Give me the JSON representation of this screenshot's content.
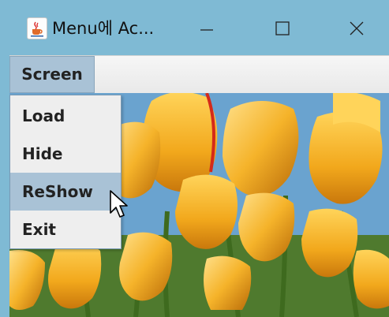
{
  "window": {
    "title": "Menu에 Ac...",
    "icon": "java-cup-icon",
    "controls": {
      "minimize": "minimize-icon",
      "maximize": "maximize-icon",
      "close": "close-icon"
    },
    "colors": {
      "titlebar": "#7fbad4",
      "menu_highlight": "#a9c2d6"
    }
  },
  "menubar": {
    "items": [
      {
        "label": "Screen",
        "active": true
      }
    ]
  },
  "popup_menu": {
    "items": [
      {
        "label": "Load",
        "highlighted": false
      },
      {
        "label": "Hide",
        "highlighted": false
      },
      {
        "label": "ReShow",
        "highlighted": true
      },
      {
        "label": "Exit",
        "highlighted": false
      }
    ]
  },
  "content": {
    "image": "yellow-tulips-photo"
  }
}
